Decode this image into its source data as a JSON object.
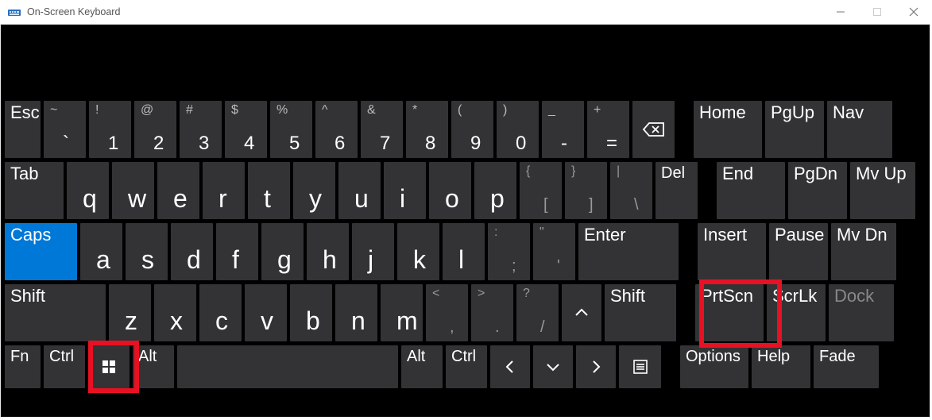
{
  "window": {
    "title": "On-Screen Keyboard"
  },
  "titlebar_controls": {
    "minimize": "—",
    "maximize": "▢",
    "close": "✕"
  },
  "rows": {
    "r1": {
      "esc": "Esc",
      "k1": {
        "top": "~",
        "bot": "`"
      },
      "k2": {
        "top": "!",
        "bot": "1"
      },
      "k3": {
        "top": "@",
        "bot": "2"
      },
      "k4": {
        "top": "#",
        "bot": "3"
      },
      "k5": {
        "top": "$",
        "bot": "4"
      },
      "k6": {
        "top": "%",
        "bot": "5"
      },
      "k7": {
        "top": "^",
        "bot": "6"
      },
      "k8": {
        "top": "&",
        "bot": "7"
      },
      "k9": {
        "top": "*",
        "bot": "8"
      },
      "k10": {
        "top": "(",
        "bot": "9"
      },
      "k11": {
        "top": ")",
        "bot": "0"
      },
      "k12": {
        "top": "_",
        "bot": "-"
      },
      "k13": {
        "top": "+",
        "bot": "="
      },
      "backspace_glyph": "⌫",
      "home": "Home",
      "pgup": "PgUp",
      "nav": "Nav"
    },
    "r2": {
      "tab": "Tab",
      "q": "q",
      "w": "w",
      "e": "e",
      "r": "r",
      "t": "t",
      "y": "y",
      "u": "u",
      "i": "i",
      "o": "o",
      "p": "p",
      "br1": {
        "top": "{",
        "bot": "["
      },
      "br2": {
        "top": "}",
        "bot": "]"
      },
      "bslash": {
        "top": "|",
        "bot": "\\"
      },
      "del": "Del",
      "end": "End",
      "pgdn": "PgDn",
      "mvup": "Mv Up"
    },
    "r3": {
      "caps": "Caps",
      "a": "a",
      "s": "s",
      "d": "d",
      "f": "f",
      "g": "g",
      "h": "h",
      "j": "j",
      "k": "k",
      "l": "l",
      "semi": {
        "top": ":",
        "bot": ";"
      },
      "apos": {
        "top": "\"",
        "bot": "'"
      },
      "enter": "Enter",
      "insert": "Insert",
      "pause": "Pause",
      "mvdn": "Mv Dn"
    },
    "r4": {
      "lshift": "Shift",
      "z": "z",
      "x": "x",
      "c": "c",
      "v": "v",
      "b": "b",
      "n": "n",
      "m": "m",
      "comma": {
        "top": "<",
        "bot": ","
      },
      "period": {
        "top": ">",
        "bot": "."
      },
      "slash": {
        "top": "?",
        "bot": "/"
      },
      "up": "∧",
      "rshift": "Shift",
      "prtscn": "PrtScn",
      "scrlk": "ScrLk",
      "dock": "Dock"
    },
    "r5": {
      "fn": "Fn",
      "ctrl": "Ctrl",
      "alt": "Alt",
      "space": "",
      "altR": "Alt",
      "ctrlR": "Ctrl",
      "left": "<",
      "down": "∨",
      "right": ">",
      "options": "Options",
      "help": "Help",
      "fade": "Fade"
    }
  }
}
